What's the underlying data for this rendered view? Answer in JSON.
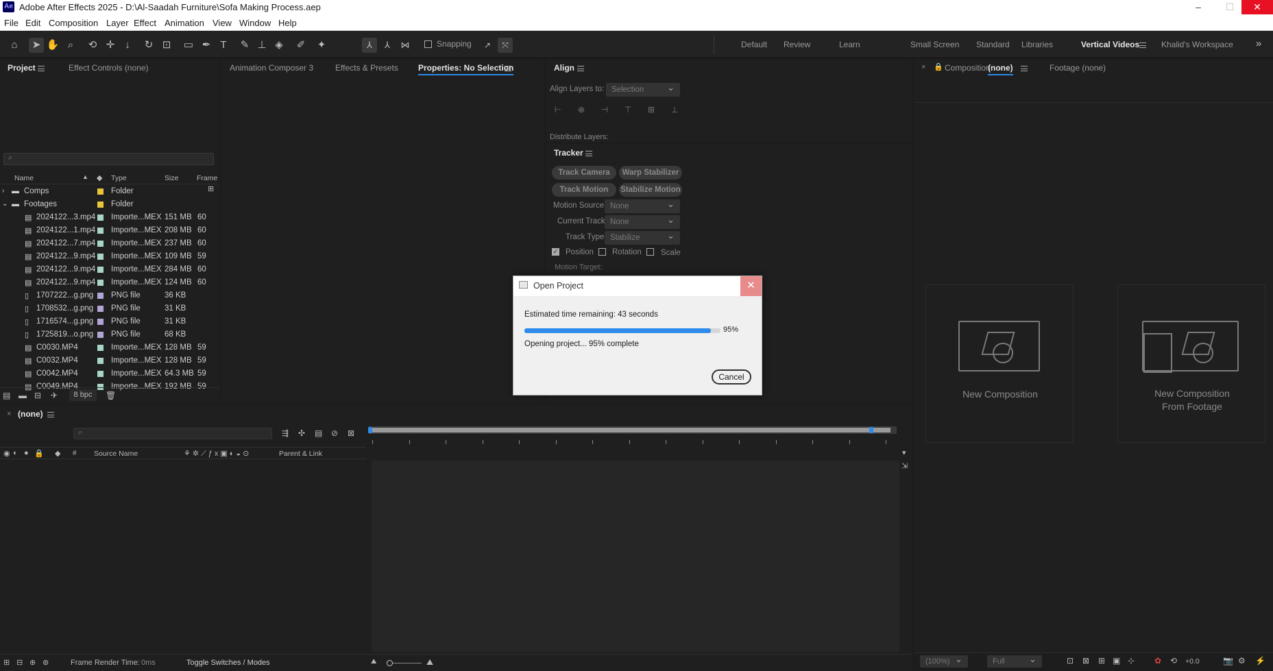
{
  "window": {
    "logo": "Ae",
    "title": "Adobe After Effects 2025 - D:\\Al-Saadah Furniture\\Sofa Making Process.aep",
    "min": "–",
    "max": "☐",
    "close": "✕"
  },
  "menu": [
    "File",
    "Edit",
    "Composition",
    "Layer",
    "Effect",
    "Animation",
    "View",
    "Window",
    "Help"
  ],
  "toolbar": {
    "snapping_label": "Snapping"
  },
  "workspaces": [
    "Default",
    "Review",
    "Learn",
    "Small Screen",
    "Standard",
    "Libraries",
    "Vertical Videos",
    "Khalid's Workspace"
  ],
  "workspace_active": "Vertical Videos",
  "project_panel": {
    "tabs": [
      "Project",
      "Effect Controls (none)"
    ],
    "search_placeholder": "",
    "columns": [
      "Name",
      "Type",
      "Size",
      "Frame R"
    ],
    "rows": [
      {
        "name": "Comps",
        "type": "Folder",
        "size": "",
        "fr": "",
        "kind": "folder",
        "color": "#e8c53a"
      },
      {
        "name": "Footages",
        "type": "Folder",
        "size": "",
        "fr": "",
        "kind": "folder-open",
        "color": "#e8c53a"
      },
      {
        "name": "2024122...3.mp4",
        "type": "Importe...MEX",
        "size": "151 MB",
        "fr": "60",
        "kind": "video",
        "color": "#a9d6c4"
      },
      {
        "name": "2024122...1.mp4",
        "type": "Importe...MEX",
        "size": "208 MB",
        "fr": "60",
        "kind": "video",
        "color": "#a9d6c4"
      },
      {
        "name": "2024122...7.mp4",
        "type": "Importe...MEX",
        "size": "237 MB",
        "fr": "60",
        "kind": "video",
        "color": "#a9d6c4"
      },
      {
        "name": "2024122...9.mp4",
        "type": "Importe...MEX",
        "size": "109 MB",
        "fr": "59",
        "kind": "video",
        "color": "#a9d6c4"
      },
      {
        "name": "2024122...9.mp4",
        "type": "Importe...MEX",
        "size": "284 MB",
        "fr": "60",
        "kind": "video",
        "color": "#a9d6c4"
      },
      {
        "name": "2024122...9.mp4",
        "type": "Importe...MEX",
        "size": "124 MB",
        "fr": "60",
        "kind": "video",
        "color": "#a9d6c4"
      },
      {
        "name": "1707222...g.png",
        "type": "PNG file",
        "size": "36 KB",
        "fr": "",
        "kind": "image",
        "color": "#b3a6d6"
      },
      {
        "name": "1708532...g.png",
        "type": "PNG file",
        "size": "31 KB",
        "fr": "",
        "kind": "image",
        "color": "#b3a6d6"
      },
      {
        "name": "1716574...g.png",
        "type": "PNG file",
        "size": "31 KB",
        "fr": "",
        "kind": "image",
        "color": "#b3a6d6"
      },
      {
        "name": "1725819...o.png",
        "type": "PNG file",
        "size": "68 KB",
        "fr": "",
        "kind": "image",
        "color": "#b3a6d6"
      },
      {
        "name": "C0030.MP4",
        "type": "Importe...MEX",
        "size": "128 MB",
        "fr": "59",
        "kind": "video",
        "color": "#a9d6c4"
      },
      {
        "name": "C0032.MP4",
        "type": "Importe...MEX",
        "size": "128 MB",
        "fr": "59",
        "kind": "video",
        "color": "#a9d6c4"
      },
      {
        "name": "C0042.MP4",
        "type": "Importe...MEX",
        "size": "64.3 MB",
        "fr": "59",
        "kind": "video",
        "color": "#a9d6c4"
      },
      {
        "name": "C0049.MP4",
        "type": "Importe...MEX",
        "size": "192 MB",
        "fr": "59",
        "kind": "video",
        "color": "#a9d6c4"
      }
    ],
    "bpc": "8 bpc"
  },
  "mid_panel": {
    "tabs": [
      "Animation Composer 3",
      "Effects & Presets",
      "Properties: No Selection"
    ]
  },
  "align_panel": {
    "title": "Align",
    "align_to_label": "Align Layers to:",
    "align_to_value": "Selection",
    "distribute_label": "Distribute Layers:"
  },
  "tracker_panel": {
    "title": "Tracker",
    "buttons": [
      "Track Camera",
      "Warp Stabilizer",
      "Track Motion",
      "Stabilize Motion"
    ],
    "motion_source_label": "Motion Source:",
    "motion_source": "None",
    "current_track_label": "Current Track:",
    "current_track": "None",
    "track_type_label": "Track Type:",
    "track_type": "Stabilize",
    "position": "Position",
    "rotation": "Rotation",
    "scale": "Scale",
    "motion_target_label": "Motion Target:"
  },
  "comp_panel": {
    "tab_prefix": "Composition",
    "tab_value": "(none)",
    "footage_tab": "Footage (none)",
    "new_comp": "New Composition",
    "new_comp_footage_1": "New Composition",
    "new_comp_footage_2": "From Footage",
    "zoom": "(100%)",
    "resolution": "Full",
    "exposure": "+0.0"
  },
  "timeline": {
    "tab": "(none)",
    "source_name": "Source Name",
    "parent_link": "Parent & Link",
    "hash": "#",
    "frame_render": "Frame Render Time:",
    "frame_render_value": "0ms",
    "toggle": "Toggle Switches / Modes"
  },
  "dialog": {
    "title": "Open Project",
    "estimate": "Estimated time remaining: 43 seconds",
    "progress": 0.95,
    "percent": "95%",
    "status": "Opening project... 95% complete",
    "cancel": "Cancel"
  },
  "colors": {
    "accent": "#2d8ceb",
    "folder": "#e8c53a",
    "video": "#a9d6c4",
    "image": "#b3a6d6"
  }
}
